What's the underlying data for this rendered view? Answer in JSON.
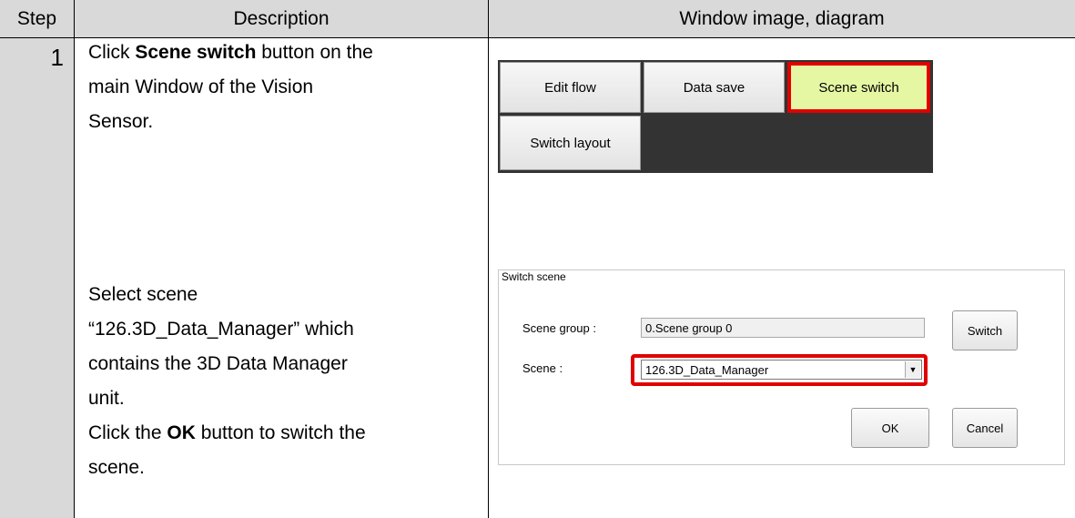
{
  "table": {
    "headers": {
      "step": "Step",
      "description": "Description",
      "window": "Window image, diagram"
    },
    "step_number": "1"
  },
  "desc": {
    "p1": [
      {
        "pre": "Click ",
        "bold": "Scene switch",
        "post": " button on the"
      },
      {
        "pre": "main Window of the Vision",
        "bold": "",
        "post": ""
      },
      {
        "pre": "Sensor.",
        "bold": "",
        "post": ""
      }
    ],
    "p2": [
      {
        "pre": "Select scene",
        "bold": "",
        "post": ""
      },
      {
        "pre": "“126.3D_Data_Manager” which",
        "bold": "",
        "post": ""
      },
      {
        "pre": "contains the 3D Data Manager",
        "bold": "",
        "post": ""
      },
      {
        "pre": "unit.",
        "bold": "",
        "post": ""
      },
      {
        "pre": "Click the ",
        "bold": "OK",
        "post": " button to switch the"
      },
      {
        "pre": "scene.",
        "bold": "",
        "post": ""
      }
    ]
  },
  "panel": {
    "edit_flow": "Edit flow",
    "data_save": "Data save",
    "scene_switch": "Scene switch",
    "switch_layout": "Switch layout",
    "highlight_color": "#e00000",
    "scene_switch_bg": "#e6f7a4"
  },
  "dialog": {
    "title": "Switch scene",
    "scene_group_label": "Scene group :",
    "scene_group_value": "0.Scene group 0",
    "scene_label": "Scene :",
    "scene_value": "126.3D_Data_Manager",
    "switch_button": "Switch",
    "ok_button": "OK",
    "cancel_button": "Cancel"
  }
}
